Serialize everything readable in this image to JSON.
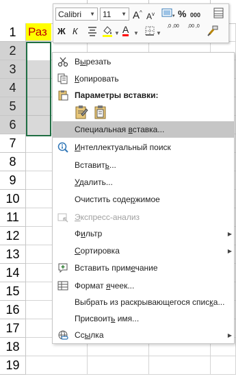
{
  "grid": {
    "row_numbers": [
      "1",
      "2",
      "3",
      "4",
      "5",
      "6",
      "7",
      "8",
      "9",
      "10",
      "11",
      "12",
      "13",
      "14",
      "15",
      "16",
      "17",
      "18",
      "19"
    ],
    "a1_value": "Раз"
  },
  "mini_toolbar": {
    "font_name": "Calibri",
    "font_size": "11",
    "grow_font": "A",
    "shrink_font": "A",
    "percent": "%",
    "thousands": "000",
    "bold": "Ж",
    "italic": "К",
    "font_color_letter": "A",
    "inc_decimal": ",0 ,00",
    "dec_decimal": ",00 ,0"
  },
  "menu": {
    "cut": {
      "pre": "В",
      "u": "ы",
      "post": "резать"
    },
    "copy": {
      "pre": "",
      "u": "К",
      "post": "опировать"
    },
    "paste_header": "Параметры вставки:",
    "paste_special": {
      "pre": "Специальная ",
      "u": "в",
      "post": "ставка..."
    },
    "smart_lookup": {
      "pre": "",
      "u": "И",
      "post": "нтеллектуальный поиск"
    },
    "insert": {
      "pre": "Вставит",
      "u": "ь",
      "post": "..."
    },
    "delete": {
      "pre": "",
      "u": "У",
      "post": "далить..."
    },
    "clear": {
      "pre": "Очистить соде",
      "u": "р",
      "post": "жимое"
    },
    "quick_analysis": {
      "pre": "",
      "u": "Э",
      "post": "кспресс-анализ"
    },
    "filter": {
      "pre": "Ф",
      "u": "и",
      "post": "льтр"
    },
    "sort": {
      "pre": "",
      "u": "С",
      "post": "ортировка"
    },
    "insert_comment": {
      "pre": "Вставить прим",
      "u": "е",
      "post": "чание"
    },
    "format_cells": {
      "pre": "Формат ",
      "u": "я",
      "post": "чеек..."
    },
    "pick_list": {
      "pre": "Выбрать из раскрывающегося спис",
      "u": "к",
      "post": "а..."
    },
    "define_name": {
      "pre": "Присвоит",
      "u": "ь",
      "post": " имя..."
    },
    "link": {
      "pre": "Сс",
      "u": "ы",
      "post": "лка"
    }
  },
  "colors": {
    "selection_border": "#1f6e43",
    "a1_fill": "#ffff00",
    "a1_text": "#c00000",
    "menu_highlight": "#c6c6c6"
  }
}
